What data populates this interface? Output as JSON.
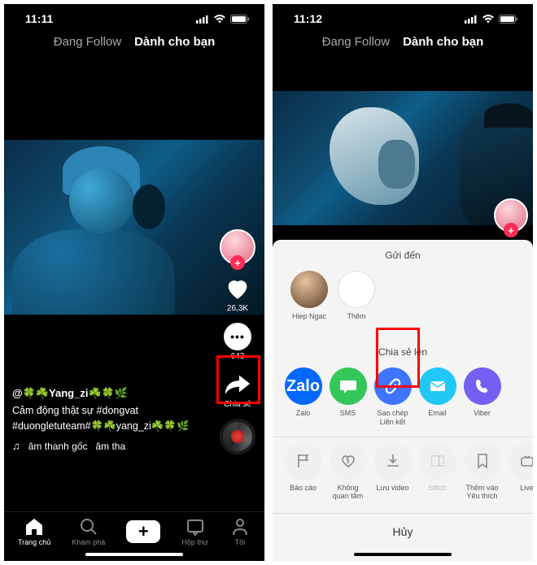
{
  "phones": {
    "left": {
      "status": {
        "time": "11:11"
      },
      "tabs": {
        "following": "Đang Follow",
        "foryou": "Dành cho bạn"
      },
      "rail": {
        "like_count": "26,3K",
        "comment_count": "643",
        "share_label": "Chia sẻ"
      },
      "caption": {
        "username": "@🍀☘️Yang_zi☘️🍀🌿",
        "line1": "Cảm động thật sự #dongvat",
        "line2": "#duongletuteam#🍀☘️yang_zi☘️🍀🌿",
        "music1": "âm thanh gốc",
        "music2": "âm tha"
      },
      "nav": {
        "home": "Trang chủ",
        "discover": "Khám phá",
        "inbox": "Hộp thư",
        "me": "Tôi"
      }
    },
    "right": {
      "status": {
        "time": "11:12"
      },
      "tabs": {
        "following": "Đang Follow",
        "foryou": "Dành cho bạn"
      },
      "sheet": {
        "send_title": "Gửi đến",
        "send_items": {
          "friend": "Hiep Ngac",
          "more": "Thêm"
        },
        "share_title": "Chia sẻ lên",
        "share_items": {
          "zalo": "Zalo",
          "sms": "SMS",
          "copylink": "Sao chép\nLiên kết",
          "email": "Email",
          "viber": "Viber"
        },
        "action_items": {
          "report": "Báo cáo",
          "not_interested": "Không\nquan tâm",
          "save": "Lưu video",
          "stitch": "Stitch",
          "favorite": "Thêm vào\nYêu thích",
          "live": "Live"
        },
        "cancel": "Hủy"
      }
    }
  }
}
